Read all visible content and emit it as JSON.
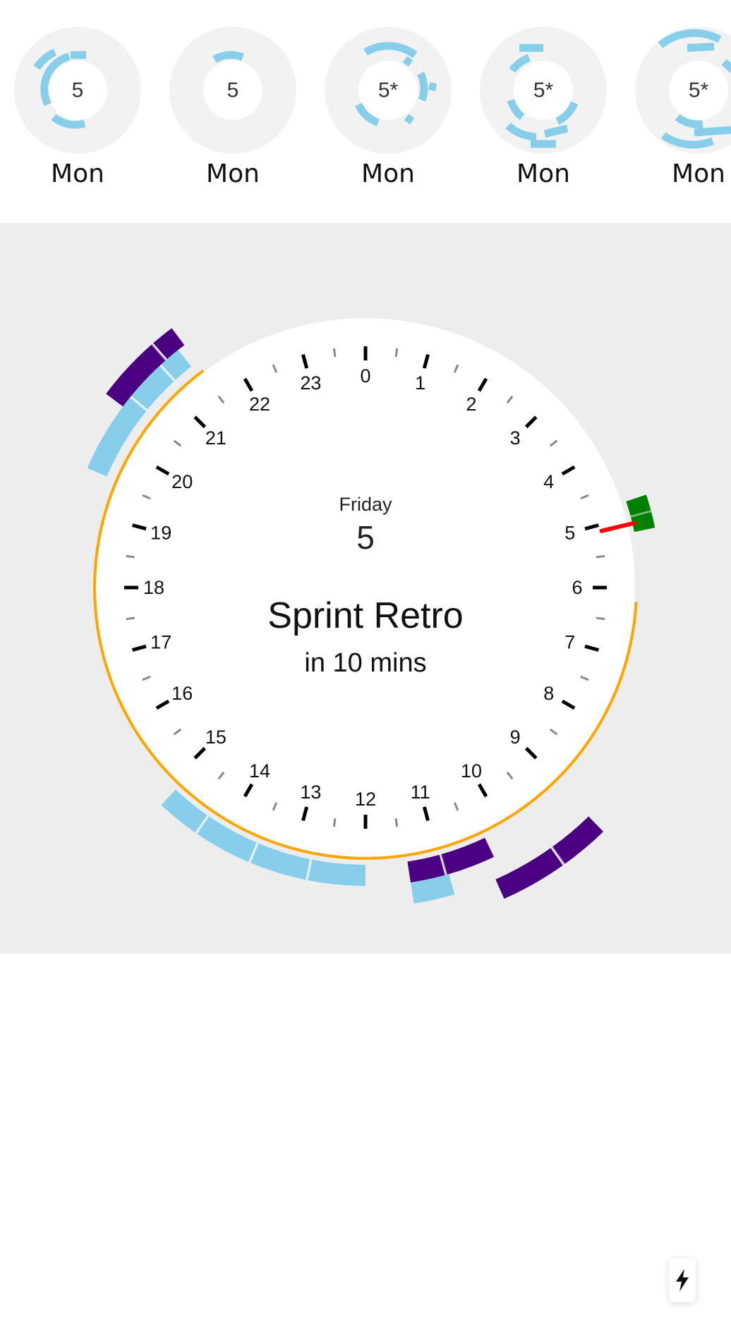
{
  "days": [
    {
      "badge": "5",
      "label": "Mon"
    },
    {
      "badge": "5",
      "label": "Mon"
    },
    {
      "badge": "5*",
      "label": "Mon"
    },
    {
      "badge": "5*",
      "label": "Mon"
    },
    {
      "badge": "5*",
      "label": "Mon"
    }
  ],
  "clock": {
    "day_name": "Friday",
    "day_number": "5",
    "event_title": "Sprint Retro",
    "event_countdown": "in 10 mins",
    "hour_labels": [
      "0",
      "1",
      "2",
      "3",
      "4",
      "5",
      "6",
      "7",
      "8",
      "9",
      "10",
      "11",
      "12",
      "13",
      "14",
      "15",
      "16",
      "17",
      "18",
      "19",
      "20",
      "21",
      "22",
      "23"
    ],
    "current_hour": 5.1
  },
  "colors": {
    "event_light": "#87ceeb",
    "event_dark": "#4b0082",
    "event_green": "#008000",
    "now_hand": "#ff0000",
    "daylight_arc": "#ffa500",
    "panel_bg": "#ededed",
    "thumb_bg": "#f2f2f2"
  },
  "fab": {
    "icon": "lightning-icon"
  }
}
